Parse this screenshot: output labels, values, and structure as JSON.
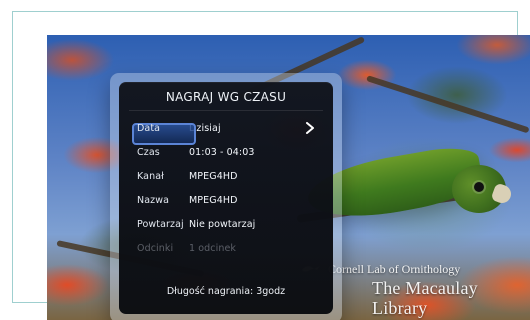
{
  "screen": {
    "watermark": {
      "line1": "Cornell Lab of Ornithology",
      "line2": "The Macaulay Library",
      "logo_icon": "bird-logo-icon"
    }
  },
  "dialog": {
    "title": "NAGRAJ WG CZASU",
    "rows": [
      {
        "label": "Data",
        "value": "Dzisiaj",
        "selected": true,
        "disabled": false,
        "has_chevron": true,
        "chevron_icon": "chevron-right-icon"
      },
      {
        "label": "Czas",
        "value": "01:03 - 04:03",
        "selected": false,
        "disabled": false,
        "has_chevron": false
      },
      {
        "label": "Kanał",
        "value": "MPEG4HD",
        "selected": false,
        "disabled": false,
        "has_chevron": false
      },
      {
        "label": "Nazwa",
        "value": "MPEG4HD",
        "selected": false,
        "disabled": false,
        "has_chevron": false
      },
      {
        "label": "Powtarzaj",
        "value": "Nie powtarzaj",
        "selected": false,
        "disabled": false,
        "has_chevron": false
      },
      {
        "label": "Odcinki",
        "value": "1 odcinek",
        "selected": false,
        "disabled": true,
        "has_chevron": false
      }
    ],
    "footer": "Długość nagrania: 3godz"
  },
  "colors": {
    "dialog_bg": "#0f121a",
    "selection": "#5b84d6",
    "text": "#f3f6fb",
    "muted_text": "#7c8594"
  }
}
